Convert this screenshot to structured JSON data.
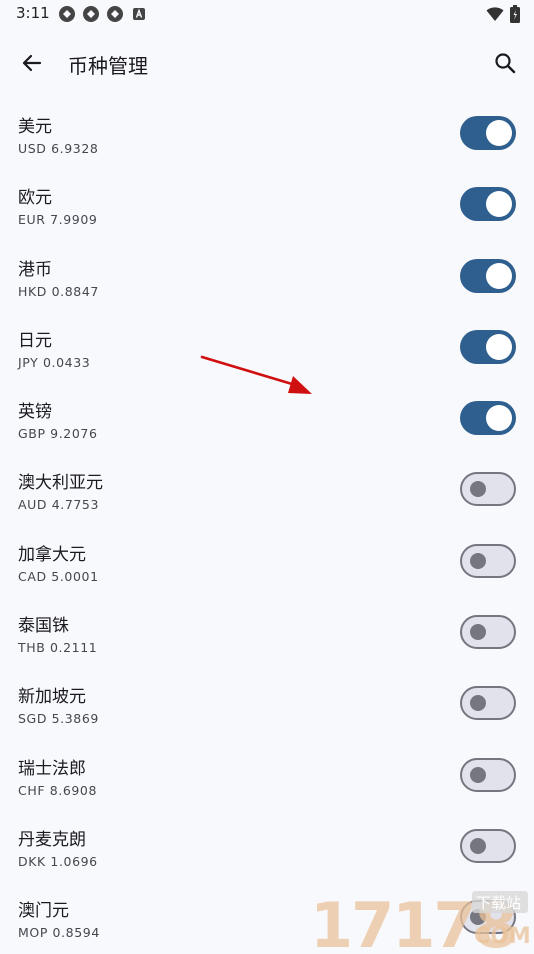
{
  "status_bar": {
    "time": "3:11"
  },
  "app_bar": {
    "title": "币种管理"
  },
  "currencies": [
    {
      "name": "美元",
      "code": "USD 6.9328",
      "enabled": true
    },
    {
      "name": "欧元",
      "code": "EUR 7.9909",
      "enabled": true
    },
    {
      "name": "港币",
      "code": "HKD 0.8847",
      "enabled": true
    },
    {
      "name": "日元",
      "code": "JPY 0.0433",
      "enabled": true
    },
    {
      "name": "英镑",
      "code": "GBP 9.2076",
      "enabled": true
    },
    {
      "name": "澳大利亚元",
      "code": "AUD 4.7753",
      "enabled": false
    },
    {
      "name": "加拿大元",
      "code": "CAD 5.0001",
      "enabled": false
    },
    {
      "name": "泰国铢",
      "code": "THB 0.2111",
      "enabled": false
    },
    {
      "name": "新加坡元",
      "code": "SGD 5.3869",
      "enabled": false
    },
    {
      "name": "瑞士法郎",
      "code": "CHF 8.6908",
      "enabled": false
    },
    {
      "name": "丹麦克朗",
      "code": "DKK 1.0696",
      "enabled": false
    },
    {
      "name": "澳门元",
      "code": "MOP 0.8594",
      "enabled": false
    }
  ],
  "colors": {
    "toggle_on": "#2e5f8e",
    "toggle_off_track": "#e1e2ec",
    "toggle_off_outline": "#757680",
    "background": "#f8f9fd",
    "annotation_arrow": "#d01010"
  },
  "icons": {
    "back": "arrow-left-icon",
    "search": "search-icon",
    "wifi": "wifi-icon",
    "battery": "battery-icon"
  },
  "watermark": {
    "digits": "17178",
    "text": "下载站",
    "domain": "COM"
  }
}
